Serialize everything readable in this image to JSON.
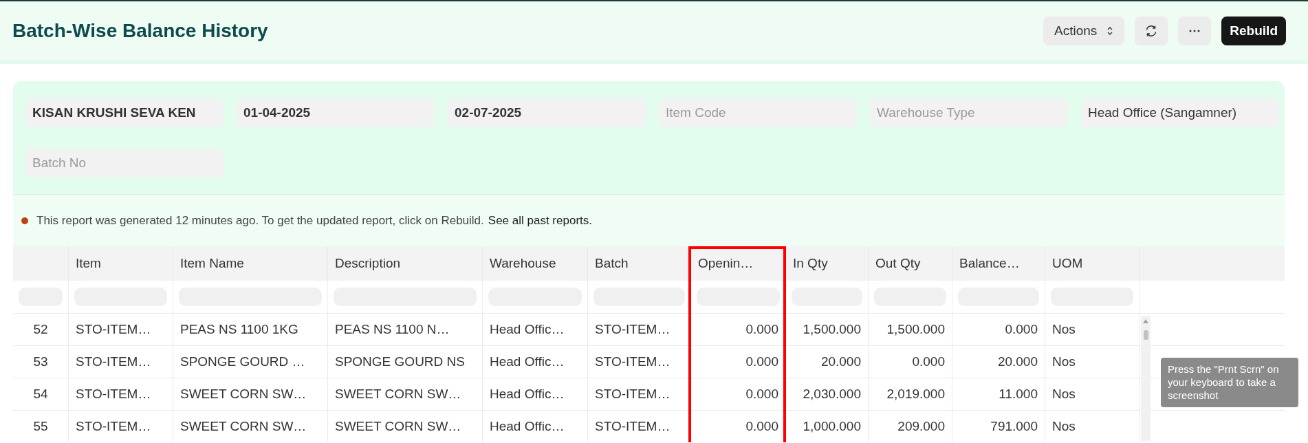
{
  "page": {
    "title": "Batch-Wise Balance History"
  },
  "toolbar": {
    "actions": "Actions",
    "rebuild": "Rebuild"
  },
  "filters": [
    {
      "value": "KISAN KRUSHI SEVA KEN"
    },
    {
      "value": "01-04-2025"
    },
    {
      "value": "02-07-2025"
    },
    {
      "placeholder": "Item Code"
    },
    {
      "placeholder": "Warehouse Type"
    },
    {
      "value": "Head Office (Sangamner)"
    },
    {
      "placeholder": "Batch No"
    }
  ],
  "notice": {
    "color": "#c0410f",
    "text": "This report was generated 12 minutes ago. To get the updated report, click on Rebuild.",
    "link": "See all past reports."
  },
  "table": {
    "columns": [
      {
        "label": "Item",
        "kind": "text"
      },
      {
        "label": "Item Name",
        "kind": "text"
      },
      {
        "label": "Description",
        "kind": "text"
      },
      {
        "label": "Warehouse",
        "kind": "text"
      },
      {
        "label": "Batch",
        "kind": "text"
      },
      {
        "label": "Openin…",
        "kind": "number",
        "highlighted": true
      },
      {
        "label": "In Qty",
        "kind": "number"
      },
      {
        "label": "Out Qty",
        "kind": "number"
      },
      {
        "label": "Balance…",
        "kind": "number"
      },
      {
        "label": "UOM",
        "kind": "text"
      }
    ],
    "rows": [
      {
        "index": "52",
        "cells": [
          "STO-ITEM…",
          "PEAS NS 1100 1KG",
          "PEAS NS 1100 N…",
          "Head Offic…",
          "STO-ITEM…",
          "0.000",
          "1,500.000",
          "1,500.000",
          "0.000",
          "Nos"
        ]
      },
      {
        "index": "53",
        "cells": [
          "STO-ITEM…",
          "SPONGE GOURD …",
          "SPONGE GOURD NS",
          "Head Offic…",
          "STO-ITEM…",
          "0.000",
          "20.000",
          "0.000",
          "20.000",
          "Nos"
        ]
      },
      {
        "index": "54",
        "cells": [
          "STO-ITEM…",
          "SWEET CORN SW…",
          "SWEET CORN SW…",
          "Head Offic…",
          "STO-ITEM…",
          "0.000",
          "2,030.000",
          "2,019.000",
          "11.000",
          "Nos"
        ]
      },
      {
        "index": "55",
        "cells": [
          "STO-ITEM…",
          "SWEET CORN SW…",
          "SWEET CORN SW…",
          "Head Offic…",
          "STO-ITEM…",
          "0.000",
          "1,000.000",
          "209.000",
          "791.000",
          "Nos"
        ]
      }
    ]
  },
  "toast": {
    "text": "Press the \"Prnt Scrn\" on your keyboard to take a screenshot"
  }
}
